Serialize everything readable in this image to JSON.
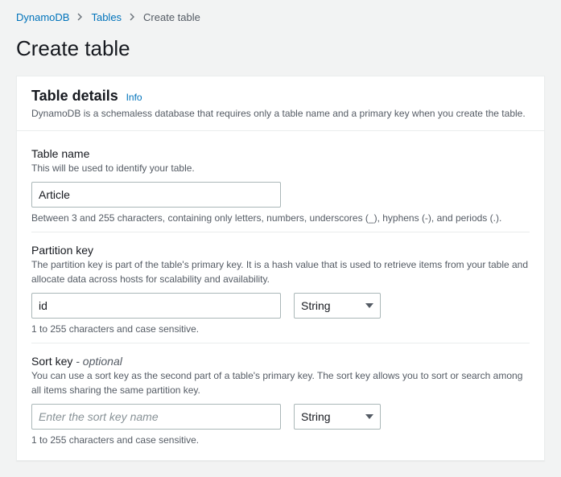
{
  "breadcrumb": {
    "items": [
      {
        "label": "DynamoDB"
      },
      {
        "label": "Tables"
      }
    ],
    "current": "Create table"
  },
  "page": {
    "title": "Create table"
  },
  "panel": {
    "heading": "Table details",
    "info_label": "Info",
    "description": "DynamoDB is a schemaless database that requires only a table name and a primary key when you create the table."
  },
  "fields": {
    "table_name": {
      "label": "Table name",
      "help": "This will be used to identify your table.",
      "value": "Article",
      "hint": "Between 3 and 255 characters, containing only letters, numbers, underscores (_), hyphens (-), and periods (.)."
    },
    "partition_key": {
      "label": "Partition key",
      "help": "The partition key is part of the table's primary key. It is a hash value that is used to retrieve items from your table and allocate data across hosts for scalability and availability.",
      "value": "id",
      "type_value": "String",
      "hint": "1 to 255 characters and case sensitive."
    },
    "sort_key": {
      "label": "Sort key",
      "optional_label": "- optional",
      "help": "You can use a sort key as the second part of a table's primary key. The sort key allows you to sort or search among all items sharing the same partition key.",
      "placeholder": "Enter the sort key name",
      "value": "",
      "type_value": "String",
      "hint": "1 to 255 characters and case sensitive."
    }
  }
}
